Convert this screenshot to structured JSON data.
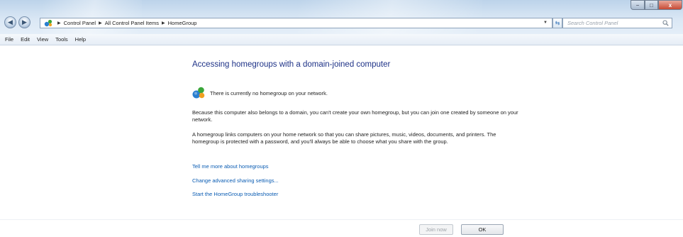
{
  "window": {
    "breadcrumb": [
      "Control Panel",
      "All Control Panel Items",
      "HomeGroup"
    ],
    "search_placeholder": "Search Control Panel",
    "caption": {
      "minimize": "−",
      "maximize": "□",
      "close": "x"
    }
  },
  "menubar": {
    "items": [
      "File",
      "Edit",
      "View",
      "Tools",
      "Help"
    ]
  },
  "content": {
    "title": "Accessing homegroups with a domain-joined computer",
    "status": "There is currently no homegroup on your network.",
    "paragraph1": "Because this computer also belongs to a domain, you can't create your own homegroup, but you can join one created by someone on your network.",
    "paragraph2": "A homegroup links computers on your home network so that you can share pictures, music, videos, documents, and printers. The homegroup is protected with a password, and you'll always be able to choose what you share with the group.",
    "links": [
      "Tell me more about homegroups",
      "Change advanced sharing settings...",
      "Start the HomeGroup troubleshooter"
    ]
  },
  "footer": {
    "join_label": "Join now",
    "ok_label": "OK"
  },
  "colors": {
    "title": "#1e3287",
    "link": "#0a5cb3",
    "close_button": "#c74a35"
  },
  "icons": [
    "back-icon",
    "forward-icon",
    "homegroup-icon",
    "refresh-icon",
    "search-icon"
  ]
}
